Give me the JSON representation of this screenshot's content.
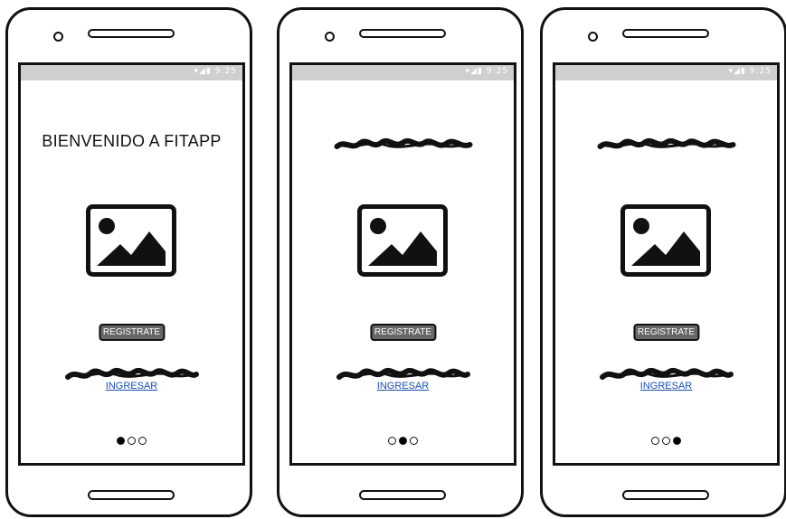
{
  "screens": [
    {
      "title": "BIENVENIDO A FITAPP",
      "title_is_scribble": false,
      "status_icons": "▾◢▮ 9:25",
      "register_button": "REGISTRATE",
      "login_link": "INGRESAR",
      "image_icon": "image-placeholder-icon",
      "pager": {
        "active_index": 1,
        "total": 3
      }
    },
    {
      "title": "",
      "title_is_scribble": true,
      "status_icons": "▾◢▮ 9:25",
      "register_button": "REGISTRATE",
      "login_link": "INGRESAR",
      "image_icon": "image-placeholder-icon",
      "pager": {
        "active_index": 2,
        "total": 3
      }
    },
    {
      "title": "",
      "title_is_scribble": true,
      "status_icons": "▾◢▮ 9:25",
      "register_button": "REGISTRATE",
      "login_link": "INGRESAR",
      "image_icon": "image-placeholder-icon",
      "pager": {
        "active_index": 3,
        "total": 3
      }
    }
  ],
  "colors": {
    "status_bar": "#cfcfcf",
    "button_fill": "#666666",
    "link": "#1a4fb0",
    "outline": "#111111"
  }
}
